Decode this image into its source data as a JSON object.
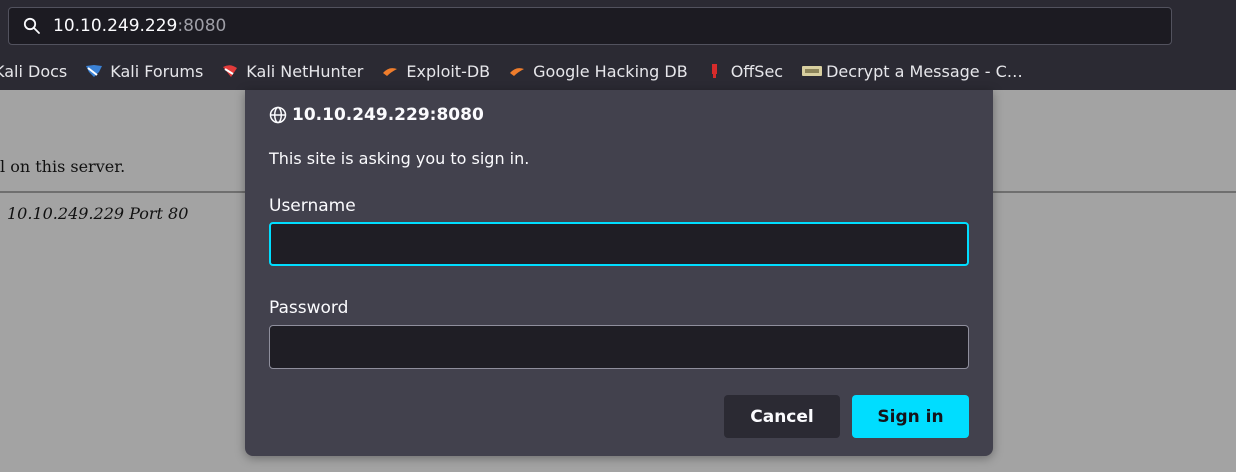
{
  "browser": {
    "url_host": "10.10.249.229",
    "url_port": ":8080",
    "bookmarks": [
      {
        "label": "Kali Docs",
        "icon": "none"
      },
      {
        "label": "Kali Forums",
        "icon": "kali-forums-icon"
      },
      {
        "label": "Kali NetHunter",
        "icon": "nethunter-icon"
      },
      {
        "label": "Exploit-DB",
        "icon": "exploit-db-icon"
      },
      {
        "label": "Google Hacking DB",
        "icon": "ghdb-icon"
      },
      {
        "label": "OffSec",
        "icon": "offsec-icon"
      },
      {
        "label": "Decrypt a Message - C…",
        "icon": "decrypt-icon"
      }
    ]
  },
  "page": {
    "line1": "l on this server.",
    "line2": "10.10.249.229 Port 80"
  },
  "dialog": {
    "origin": "10.10.249.229:8080",
    "message": "This site is asking you to sign in.",
    "username_label": "Username",
    "username_value": "",
    "password_label": "Password",
    "password_value": "",
    "cancel_label": "Cancel",
    "signin_label": "Sign in"
  },
  "colors": {
    "accent": "#00ddff",
    "dialog_bg": "#42414d",
    "toolbar_bg": "#2b2a33",
    "page_bg": "#a3a3a3"
  }
}
